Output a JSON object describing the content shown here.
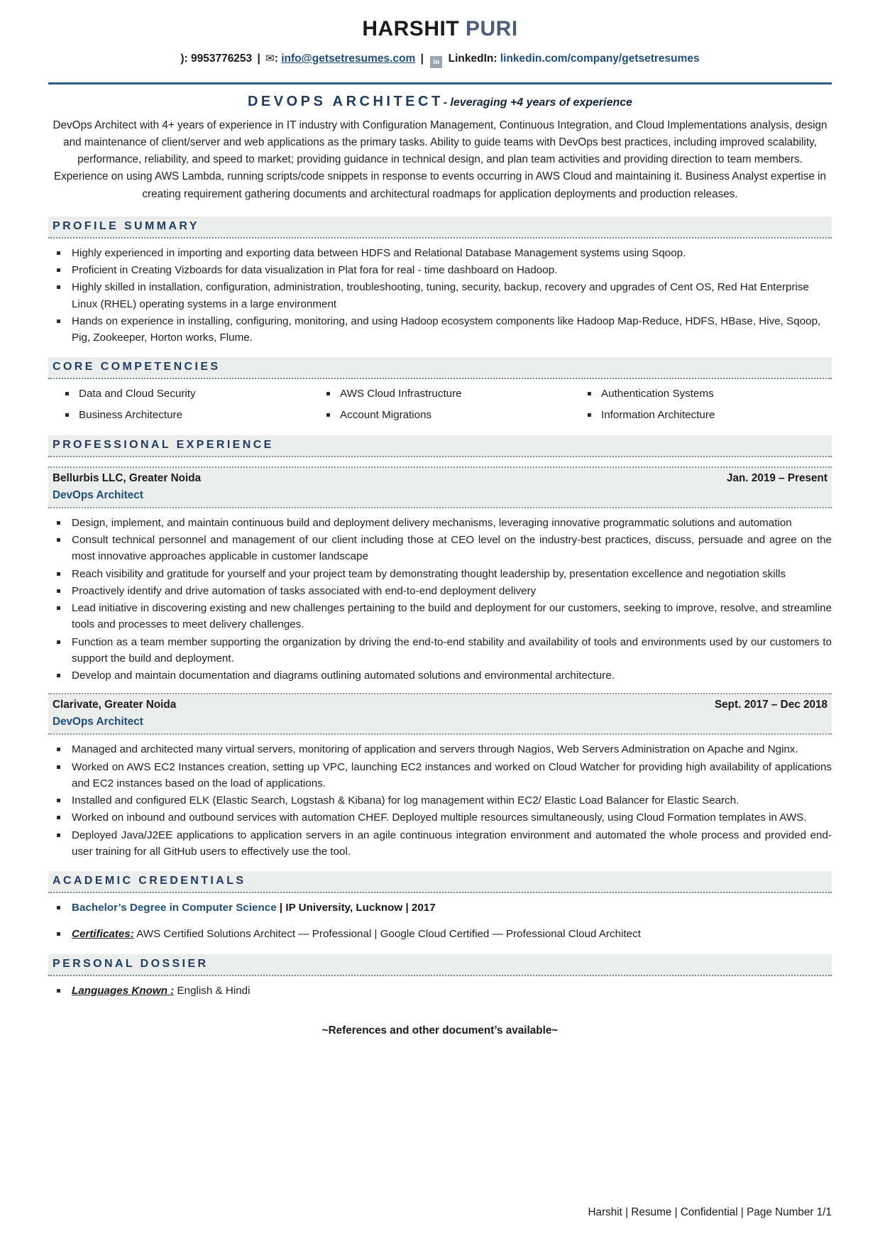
{
  "header": {
    "first_name": "HARSHIT",
    "last_name": "PURI",
    "phone_icon": "phone-icon",
    "phone_label": "):",
    "phone": "9953776253",
    "mail_icon": "✉",
    "mail_label": ":",
    "email": "info@getsetresumes.com",
    "linkedin_icon": "in",
    "linkedin_label": "LinkedIn:",
    "linkedin_url": "linkedin.com/company/getsetresumes",
    "separator": "|"
  },
  "title": {
    "role": "DEVOPS ARCHITECT",
    "tagline": "- leveraging +4 years of experience"
  },
  "summary": "DevOps Architect with 4+ years of experience in IT industry with Configuration Management, Continuous Integration, and Cloud Implementations analysis, design and maintenance of client/server and web applications as the primary tasks. Ability to guide teams with DevOps best practices, including improved scalability, performance, reliability, and speed to market; providing guidance in technical design, and plan team activities and providing direction to team members. Experience on using AWS Lambda, running scripts/code snippets in response to events occurring in AWS Cloud and maintaining it. Business Analyst expertise in creating requirement gathering documents and architectural roadmaps for application deployments and production releases.",
  "sections": {
    "profile_summary": "PROFILE SUMMARY",
    "core_competencies": "CORE COMPETENCIES",
    "professional_experience": "PROFESSIONAL EXPERIENCE",
    "academic_credentials": "ACADEMIC CREDENTIALS",
    "personal_dossier": "PERSONAL DOSSIER"
  },
  "profile_summary_items": [
    "Highly experienced in importing and exporting data between HDFS and Relational Database Management systems using Sqoop.",
    "Proficient in Creating Vizboards for data visualization in Plat fora for real - time dashboard on Hadoop.",
    "Highly skilled in installation, configuration, administration, troubleshooting, tuning, security, backup, recovery and upgrades of Cent OS, Red Hat Enterprise Linux (RHEL) operating systems in a large environment",
    "Hands on experience in installing, configuring, monitoring, and using Hadoop ecosystem components like Hadoop Map-Reduce, HDFS, HBase, Hive, Sqoop, Pig, Zookeeper, Horton works, Flume."
  ],
  "core_competencies_items": [
    "Data and Cloud Security",
    "AWS Cloud Infrastructure",
    "Authentication Systems",
    "Business Architecture",
    "Account Migrations",
    "Information Architecture"
  ],
  "experience": [
    {
      "company": "Bellurbis LLC, Greater Noida",
      "dates": "Jan. 2019 – Present",
      "role": "DevOps Architect",
      "bullets": [
        "Design, implement, and maintain continuous build and deployment delivery mechanisms, leveraging innovative programmatic solutions and automation",
        "Consult technical personnel and management of our client including those at CEO level on the industry-best practices, discuss, persuade and agree on the most innovative approaches applicable in customer landscape",
        "Reach visibility and gratitude for yourself and your project team by demonstrating thought leadership by, presentation excellence and negotiation skills",
        "Proactively identify and drive automation of tasks associated with end-to-end deployment delivery",
        "Lead initiative in discovering existing and new challenges pertaining to the build and deployment for our customers, seeking to improve, resolve, and streamline tools and processes to meet delivery challenges.",
        "Function as a team member supporting the organization by driving the end-to-end stability and availability of tools and environments used by our customers to support the build and deployment.",
        "Develop and maintain documentation and diagrams outlining automated solutions and environmental architecture."
      ]
    },
    {
      "company": "Clarivate, Greater Noida",
      "dates": "Sept. 2017 – Dec 2018",
      "role": "DevOps Architect",
      "bullets": [
        "Managed and architected many virtual servers, monitoring of application and servers through Nagios, Web Servers Administration on Apache and Nginx.",
        "Worked on AWS EC2 Instances creation, setting up VPC, launching EC2 instances and worked on Cloud Watcher for providing high availability of applications and EC2 instances based on the load of applications.",
        "Installed and configured ELK (Elastic Search, Logstash & Kibana) for log management within EC2/ Elastic Load Balancer for Elastic Search.",
        "Worked on inbound and outbound services with automation CHEF. Deployed multiple resources simultaneously, using Cloud Formation templates in AWS.",
        "Deployed Java/J2EE applications to application servers in an agile continuous integration environment and automated the whole process and provided end-user training for all GitHub users to effectively use the tool."
      ]
    }
  ],
  "academic": {
    "degree": "Bachelor’s Degree in Computer Science",
    "degree_rest": " | IP University, Lucknow | 2017",
    "certificates_label": "Certificates:",
    "certificates_value": " AWS Certified Solutions Architect — Professional | Google Cloud Certified — Professional Cloud Architect"
  },
  "personal": {
    "languages_label": "Languages Known :",
    "languages_value": " English & Hindi"
  },
  "references_note": "~References and other document’s available~",
  "footer": "Harshit | Resume | Confidential | Page Number 1/1",
  "colors": {
    "accent_navy": "#1f3d63",
    "link_blue": "#1f4e79",
    "rule_blue": "#2e5f86",
    "band_gray": "#eceded",
    "name_last_gray": "#4a5f7a"
  }
}
